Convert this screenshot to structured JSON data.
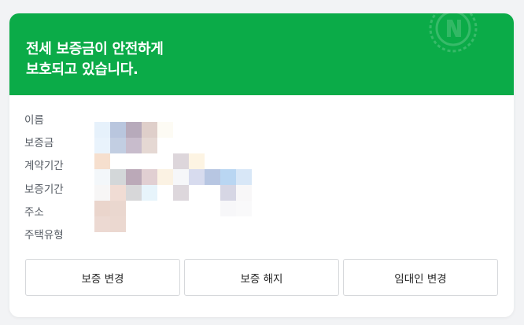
{
  "banner": {
    "title_line1": "전세 보증금이 안전하게",
    "title_line2": "보호되고 있습니다.",
    "color": "#0bab48"
  },
  "info": {
    "labels": [
      "이름",
      "보증금",
      "계약기간",
      "보증기간",
      "주소",
      "주택유형"
    ]
  },
  "actions": {
    "change_guarantee": "보증 변경",
    "cancel_guarantee": "보증 해지",
    "change_landlord": "임대인 변경"
  }
}
